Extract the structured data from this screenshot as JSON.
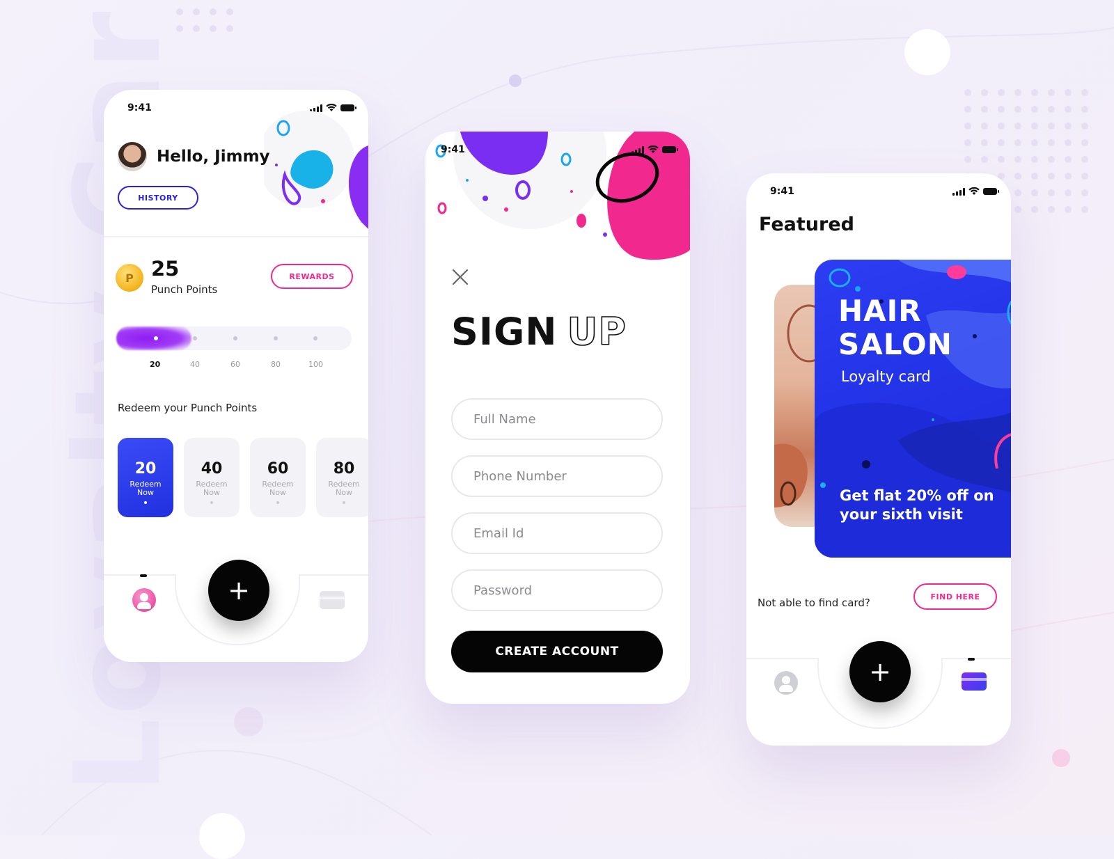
{
  "background": {
    "watermark": "Loyalty Car"
  },
  "colors": {
    "brand_blue": "#2a1ee0",
    "brand_pink": "#f1288e",
    "purple": "#8f1df3",
    "black": "#050505"
  },
  "phone1": {
    "status_time": "9:41",
    "greeting": "Hello, Jimmy",
    "history_label": "HISTORY",
    "coin_letter": "P",
    "points_value": "25",
    "points_label": "Punch Points",
    "rewards_label": "REWARDS",
    "progress_fraction": 0.2,
    "ticks": [
      "20",
      "40",
      "60",
      "80",
      "100"
    ],
    "redeem_title": "Redeem your Punch Points",
    "redeem_cards": [
      {
        "points": "20",
        "line1": "Redeem",
        "line2": "Now",
        "active": true
      },
      {
        "points": "40",
        "line1": "Redeem",
        "line2": "Now",
        "active": false
      },
      {
        "points": "60",
        "line1": "Redeem",
        "line2": "Now",
        "active": false
      },
      {
        "points": "80",
        "line1": "Redeem",
        "line2": "Now",
        "active": false
      }
    ],
    "fab_symbol": "+"
  },
  "phone2": {
    "status_time": "9:41",
    "title_solid": "SIGN",
    "title_outline": "UP",
    "fields": {
      "full_name": "Full Name",
      "phone": "Phone Number",
      "email": "Email Id",
      "password": "Password"
    },
    "cta_label": "CREATE ACCOUNT"
  },
  "phone3": {
    "status_time": "9:41",
    "title": "Featured",
    "card_title_line1": "HAIR",
    "card_title_line2": "SALON",
    "card_subtitle": "Loyalty card",
    "card_offer": "Get flat 20% off on your sixth visit",
    "find_text": "Not able to find card?",
    "find_label": "FIND HERE",
    "fab_symbol": "+"
  }
}
